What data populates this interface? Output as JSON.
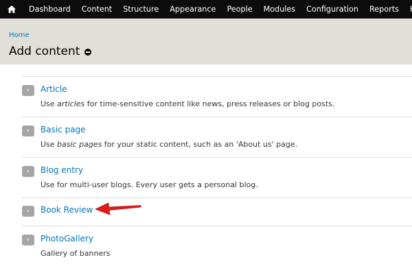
{
  "toolbar": {
    "home_icon": "home-icon",
    "items": [
      "Dashboard",
      "Content",
      "Structure",
      "Appearance",
      "People",
      "Modules",
      "Configuration",
      "Reports",
      "Help"
    ]
  },
  "header": {
    "breadcrumb": "Home",
    "title": "Add content",
    "shortcut_icon": "remove-shortcut-icon"
  },
  "content_types": [
    {
      "name": "Article",
      "desc_pre": "Use ",
      "desc_em": "articles",
      "desc_post": " for time-sensitive content like news, press releases or blog posts."
    },
    {
      "name": "Basic page",
      "desc_pre": "Use ",
      "desc_em": "basic pages",
      "desc_post": " for your static content, such as an 'About us' page."
    },
    {
      "name": "Blog entry",
      "desc_pre": "Use for multi-user blogs. Every user gets a personal blog.",
      "desc_em": "",
      "desc_post": ""
    },
    {
      "name": "Book Review",
      "desc_pre": "",
      "desc_em": "",
      "desc_post": ""
    },
    {
      "name": "PhotoGallery",
      "desc_pre": "Gallery of banners",
      "desc_em": "",
      "desc_post": ""
    }
  ],
  "colors": {
    "toolbar_bg": "#0c0c0c",
    "header_bg": "#e0e0d8",
    "link": "#0074bd",
    "annotation": "#e01b1b"
  }
}
